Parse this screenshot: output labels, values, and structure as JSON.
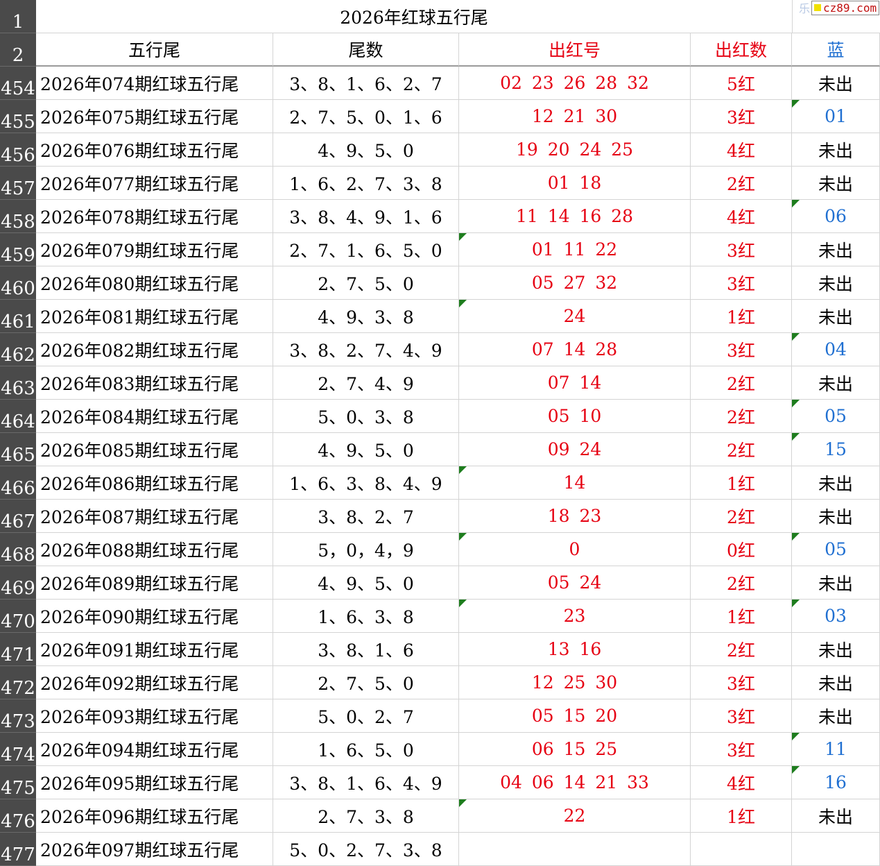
{
  "title_row": {
    "row_number": "1",
    "title": "2026年红球五行尾"
  },
  "watermark": {
    "ghost": "乐",
    "logo": "cz89.com"
  },
  "header": {
    "row_number": "2",
    "col_name": "五行尾",
    "col_tails": "尾数",
    "col_red": "出红号",
    "col_count": "出红数",
    "col_blue": "蓝"
  },
  "colors": {
    "red": "#e60012",
    "blue": "#1f6fd1",
    "rownum_bg": "#4a4a4a",
    "marker": "#1e7d1e"
  },
  "rows": [
    {
      "num": "454",
      "name": "2026年074期红球五行尾",
      "tails": "3、8、1、6、2、7",
      "red": "02 23 26 28 32",
      "count": "5红",
      "blue": "未出",
      "red_mark": false,
      "blue_mark": false
    },
    {
      "num": "455",
      "name": "2026年075期红球五行尾",
      "tails": "2、7、5、0、1、6",
      "red": "12 21 30",
      "count": "3红",
      "blue": "01",
      "red_mark": false,
      "blue_mark": true
    },
    {
      "num": "456",
      "name": "2026年076期红球五行尾",
      "tails": "4、9、5、0",
      "red": "19 20 24 25",
      "count": "4红",
      "blue": "未出",
      "red_mark": false,
      "blue_mark": false
    },
    {
      "num": "457",
      "name": "2026年077期红球五行尾",
      "tails": "1、6、2、7、3、8",
      "red": "01 18",
      "count": "2红",
      "blue": "未出",
      "red_mark": false,
      "blue_mark": false
    },
    {
      "num": "458",
      "name": "2026年078期红球五行尾",
      "tails": "3、8、4、9、1、6",
      "red": "11 14 16 28",
      "count": "4红",
      "blue": "06",
      "red_mark": false,
      "blue_mark": true
    },
    {
      "num": "459",
      "name": "2026年079期红球五行尾",
      "tails": "2、7、1、6、5、0",
      "red": "01 11 22",
      "count": "3红",
      "blue": "未出",
      "red_mark": true,
      "blue_mark": false
    },
    {
      "num": "460",
      "name": "2026年080期红球五行尾",
      "tails": "2、7、5、0",
      "red": "05 27 32",
      "count": "3红",
      "blue": "未出",
      "red_mark": false,
      "blue_mark": false
    },
    {
      "num": "461",
      "name": "2026年081期红球五行尾",
      "tails": "4、9、3、8",
      "red": "24",
      "count": "1红",
      "blue": "未出",
      "red_mark": true,
      "blue_mark": false
    },
    {
      "num": "462",
      "name": "2026年082期红球五行尾",
      "tails": "3、8、2、7、4、9",
      "red": "07 14 28",
      "count": "3红",
      "blue": "04",
      "red_mark": false,
      "blue_mark": true
    },
    {
      "num": "463",
      "name": "2026年083期红球五行尾",
      "tails": "2、7、4、9",
      "red": "07 14",
      "count": "2红",
      "blue": "未出",
      "red_mark": false,
      "blue_mark": false
    },
    {
      "num": "464",
      "name": "2026年084期红球五行尾",
      "tails": "5、0、3、8",
      "red": "05 10",
      "count": "2红",
      "blue": "05",
      "red_mark": false,
      "blue_mark": true
    },
    {
      "num": "465",
      "name": "2026年085期红球五行尾",
      "tails": "4、9、5、0",
      "red": "09 24",
      "count": "2红",
      "blue": "15",
      "red_mark": false,
      "blue_mark": true
    },
    {
      "num": "466",
      "name": "2026年086期红球五行尾",
      "tails": "1、6、3、8、4、9",
      "red": "14",
      "count": "1红",
      "blue": "未出",
      "red_mark": true,
      "blue_mark": false
    },
    {
      "num": "467",
      "name": "2026年087期红球五行尾",
      "tails": "3、8、2、7",
      "red": "18 23",
      "count": "2红",
      "blue": "未出",
      "red_mark": false,
      "blue_mark": false
    },
    {
      "num": "468",
      "name": "2026年088期红球五行尾",
      "tails": "5，0，4，9",
      "red": "0",
      "count": "0红",
      "blue": "05",
      "red_mark": true,
      "blue_mark": true
    },
    {
      "num": "469",
      "name": "2026年089期红球五行尾",
      "tails": "4、9、5、0",
      "red": "05 24",
      "count": "2红",
      "blue": "未出",
      "red_mark": false,
      "blue_mark": false
    },
    {
      "num": "470",
      "name": "2026年090期红球五行尾",
      "tails": "1、6、3、8",
      "red": "23",
      "count": "1红",
      "blue": "03",
      "red_mark": true,
      "blue_mark": true
    },
    {
      "num": "471",
      "name": "2026年091期红球五行尾",
      "tails": "3、8、1、6",
      "red": "13 16",
      "count": "2红",
      "blue": "未出",
      "red_mark": false,
      "blue_mark": false
    },
    {
      "num": "472",
      "name": "2026年092期红球五行尾",
      "tails": "2、7、5、0",
      "red": "12 25 30",
      "count": "3红",
      "blue": "未出",
      "red_mark": false,
      "blue_mark": false
    },
    {
      "num": "473",
      "name": "2026年093期红球五行尾",
      "tails": "5、0、2、7",
      "red": "05 15 20",
      "count": "3红",
      "blue": "未出",
      "red_mark": false,
      "blue_mark": false
    },
    {
      "num": "474",
      "name": "2026年094期红球五行尾",
      "tails": "1、6、5、0",
      "red": "06 15 25",
      "count": "3红",
      "blue": "11",
      "red_mark": false,
      "blue_mark": true
    },
    {
      "num": "475",
      "name": "2026年095期红球五行尾",
      "tails": "3、8、1、6、4、9",
      "red": "04 06 14 21 33",
      "count": "4红",
      "blue": "16",
      "red_mark": false,
      "blue_mark": true
    },
    {
      "num": "476",
      "name": "2026年096期红球五行尾",
      "tails": "2、7、3、8",
      "red": "22",
      "count": "1红",
      "blue": "未出",
      "red_mark": true,
      "blue_mark": false
    },
    {
      "num": "477",
      "name": "2026年097期红球五行尾",
      "tails": "5、0、2、7、3、8",
      "red": "",
      "count": "",
      "blue": "",
      "red_mark": false,
      "blue_mark": false
    }
  ]
}
